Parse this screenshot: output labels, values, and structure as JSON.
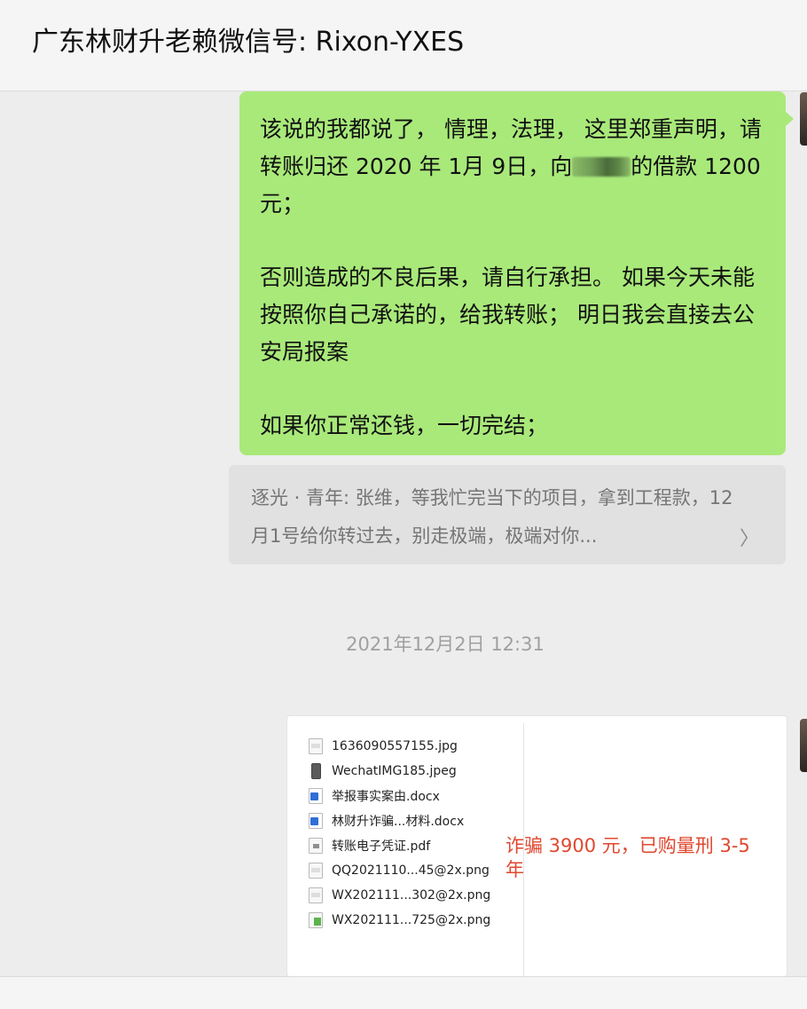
{
  "header": {
    "title": "广东林财升老赖微信号: Rixon-YXES"
  },
  "messages": {
    "outgoing": {
      "para1_before": "该说的我都说了， 情理，法理， 这里郑重声明，请转账归还 2020 年 1月 9日，向",
      "para1_after": "的借款 1200 元；",
      "para2": "否则造成的不良后果，请自行承担。 如果今天未能按照你自己承诺的，给我转账； 明日我会直接去公安局报案",
      "para3": "如果你正常还钱，一切完结；"
    },
    "quote": {
      "text": "逐光 · 青年: 张维，等我忙完当下的项目，拿到工程款，12月1号给你转过去，别走极端，极端对你..."
    },
    "timestamp": "2021年12月2日 12:31",
    "image": {
      "files": [
        {
          "name": "1636090557155.jpg",
          "icon": "image-file-icon"
        },
        {
          "name": "WechatIMG185.jpeg",
          "icon": "phone-image-icon"
        },
        {
          "name": "举报事实案由.docx",
          "icon": "word-doc-icon"
        },
        {
          "name": "林财升诈骗...材料.docx",
          "icon": "word-doc-icon"
        },
        {
          "name": "转账电子凭证.pdf",
          "icon": "pdf-file-icon"
        },
        {
          "name": "QQ2021110...45@2x.png",
          "icon": "image-file-icon"
        },
        {
          "name": "WX202111...302@2x.png",
          "icon": "image-file-icon"
        },
        {
          "name": "WX202111...725@2x.png",
          "icon": "green-image-icon"
        }
      ],
      "note": "诈骗 3900 元，已购量刑 3-5 年"
    }
  },
  "colors": {
    "outgoing_bubble": "#a9e97a",
    "chat_background": "#ededed",
    "note_red": "#e0482f"
  }
}
